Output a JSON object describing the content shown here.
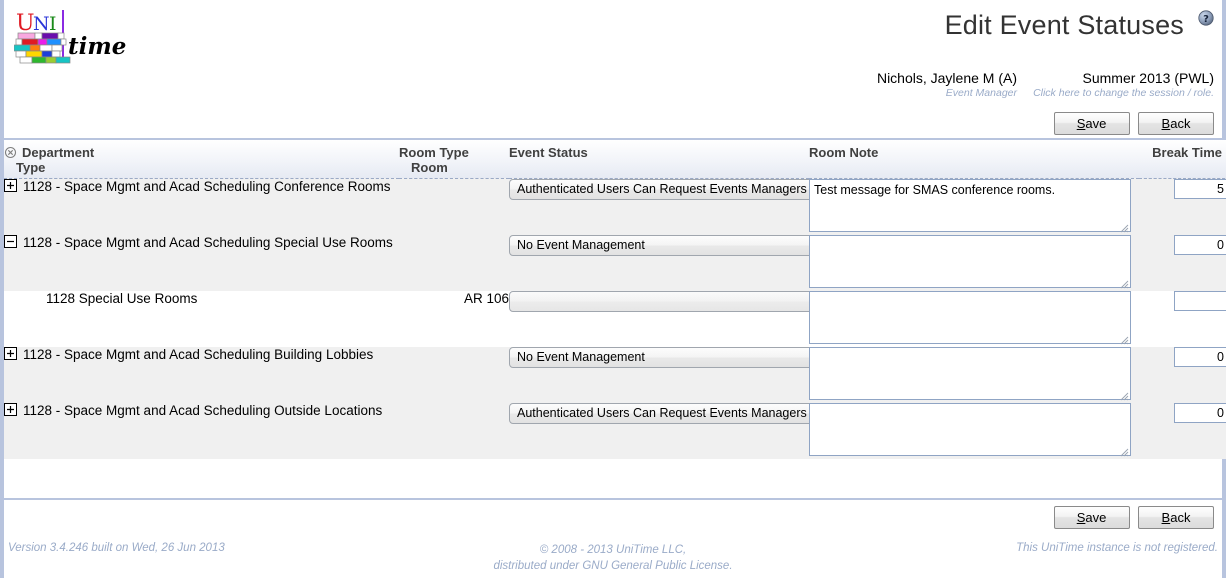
{
  "header": {
    "title": "Edit Event Statuses",
    "help_icon": "help-question-icon",
    "logo_text_uni": "UNI",
    "logo_text_time": "time",
    "user_name": "Nichols, Jaylene M (A)",
    "user_role": "Event Manager",
    "session_name": "Summer 2013 (PWL)",
    "session_link": "Click here to change the session / role."
  },
  "toolbar": {
    "save_label_pre": "S",
    "save_label_post": "ave",
    "back_label_pre": "B",
    "back_label_post": "ack"
  },
  "table": {
    "collapse_all_icon": "collapse-all-icon",
    "columns": {
      "department": "Department",
      "type": "Type",
      "room_type": "Room Type",
      "room": "Room",
      "event_status": "Event Status",
      "room_note": "Room Note",
      "break_time": "Break Time"
    },
    "rows": [
      {
        "expander": "plus-icon",
        "department": "1128 - Space Mgmt and Acad Scheduling Conference Rooms",
        "room_type": "",
        "status": "Authenticated Users Can Request Events Managers Can Approve",
        "note": "Test message for SMAS conference rooms.",
        "break_time": "5",
        "indent": false,
        "white": false,
        "status_empty": false
      },
      {
        "expander": "minus-icon",
        "department": "1128 - Space Mgmt and Acad Scheduling Special Use Rooms",
        "room_type": "",
        "status": "No Event Management",
        "note": "",
        "break_time": "0",
        "indent": false,
        "white": false,
        "status_empty": false
      },
      {
        "expander": "",
        "department": "1128 Special Use Rooms",
        "room_type": "AR 106",
        "status": "",
        "note": "",
        "break_time": "",
        "indent": true,
        "white": true,
        "status_empty": true
      },
      {
        "expander": "plus-icon",
        "department": "1128 - Space Mgmt and Acad Scheduling Building Lobbies",
        "room_type": "",
        "status": "No Event Management",
        "note": "",
        "break_time": "0",
        "indent": false,
        "white": false,
        "status_empty": false
      },
      {
        "expander": "plus-icon",
        "department": "1128 - Space Mgmt and Acad Scheduling Outside Locations",
        "room_type": "",
        "status": "Authenticated Users Can Request Events Managers Can Approve",
        "note": "",
        "break_time": "0",
        "indent": false,
        "white": false,
        "status_empty": false
      }
    ]
  },
  "footer": {
    "version": "Version 3.4.246 built on Wed, 26 Jun 2013",
    "copyright_line1": "© 2008 - 2013 UniTime LLC,",
    "copyright_line2": "distributed under GNU General Public License.",
    "registration": "This UniTime instance is not registered."
  },
  "colors": {
    "accent_border": "#b8c4de",
    "footer_text": "#9aabc8",
    "row_alt": "#f0f0f0"
  }
}
